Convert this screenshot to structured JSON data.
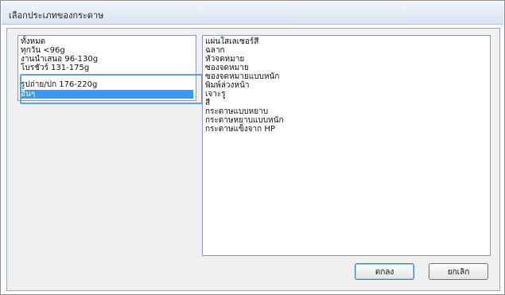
{
  "window": {
    "title": "เลือกประเภทของกระดาษ"
  },
  "left_list": {
    "items": [
      "ทั้งหมด",
      "ทุกวัน <96g",
      "งานนำเสนอ 96-130g",
      "โบรชัวร์ 131-175g",
      "รูปถ่าย/ปก 176-220g",
      "อื่นๆ"
    ],
    "selected": "อื่นๆ"
  },
  "right_list": {
    "items": [
      "แผ่นใสเลเซอร์สี",
      "ฉลาก",
      "หัวจดหมาย",
      "ซองจดหมาย",
      "ซองจดหมายแบบหนัก",
      "พิมพ์ล่วงหน้า",
      "เจาะรู",
      "สี",
      "กระดาษแบบหยาบ",
      "กระดาษหยาบแบบหนัก",
      "กระดาษแข็งจาก HP"
    ]
  },
  "buttons": {
    "ok": "ตกลง",
    "cancel": "ยกเลิก"
  }
}
